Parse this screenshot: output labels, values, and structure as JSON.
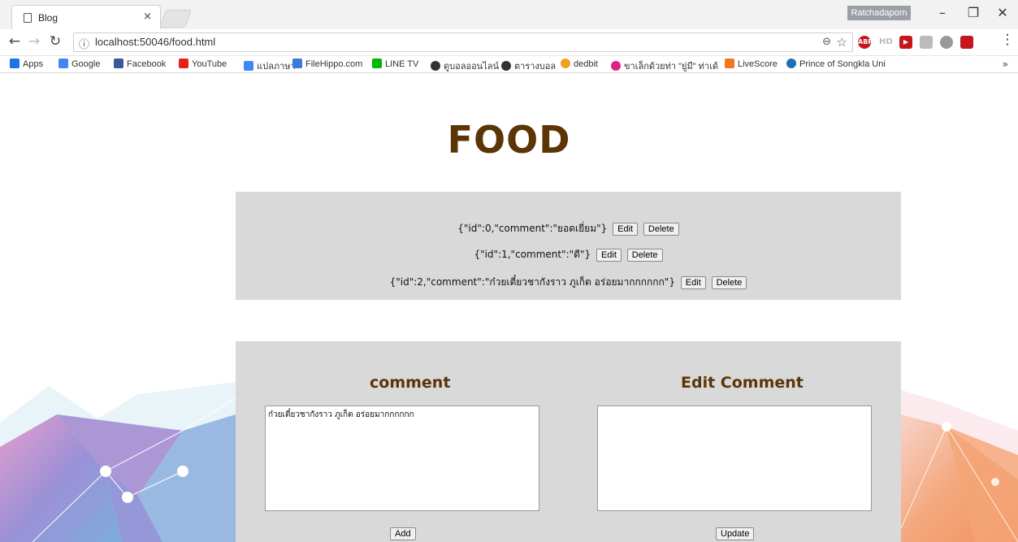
{
  "browser": {
    "tab_title": "Blog",
    "tab_close": "×",
    "profile_name": "Ratchadaporn",
    "url": "localhost:50046/food.html",
    "extensions": [
      "ABP",
      "HD"
    ]
  },
  "bookmarks": [
    {
      "label": "Apps",
      "color": "#1a73e8"
    },
    {
      "label": "Google",
      "color": "#4285f4"
    },
    {
      "label": "Facebook",
      "color": "#3b5998"
    },
    {
      "label": "YouTube",
      "color": "#e62117"
    },
    {
      "label": "แปลภาษา",
      "color": "#4285f4"
    },
    {
      "label": "FileHippo.com",
      "color": "#3a7bd5"
    },
    {
      "label": "LINE TV",
      "color": "#00b900"
    },
    {
      "label": "ดูบอลออนไลน์",
      "color": "#333333"
    },
    {
      "label": "ตารางบอล",
      "color": "#333333"
    },
    {
      "label": "dedbit",
      "color": "#f0a020"
    },
    {
      "label": "ขาเล็กด้วยท่า \"ยู่มี\" ท่าเด้",
      "color": "#e0208a"
    },
    {
      "label": "LiveScore",
      "color": "#f07820"
    },
    {
      "label": "Prince of Songkla Uni",
      "color": "#1f6fb2"
    }
  ],
  "page": {
    "heading": "FOOD",
    "comments": [
      {
        "text": "{\"id\":0,\"comment\":\"ยอดเยี่ยม\"}"
      },
      {
        "text": "{\"id\":1,\"comment\":\"ดี\"}"
      },
      {
        "text": "{\"id\":2,\"comment\":\"ก๋วยเตี๋ยวชากังราว ภูเก็ต อร่อยมากกกกกก\"}"
      }
    ],
    "edit_label": "Edit",
    "delete_label": "Delete",
    "comment_title": "comment",
    "comment_value": "ก๋วยเตี๋ยวชากังราว ภูเก็ต อร่อยมากกกกกก",
    "add_label": "Add",
    "edit_title": "Edit Comment",
    "edit_value": "",
    "update_label": "Update"
  }
}
